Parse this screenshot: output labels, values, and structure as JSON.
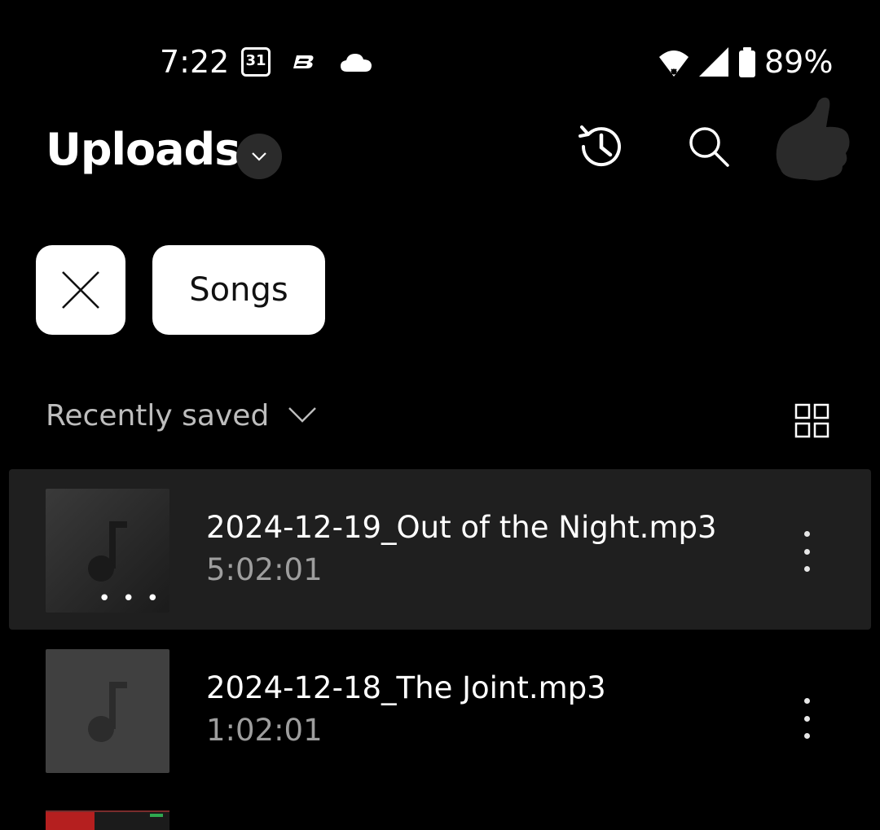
{
  "status_bar": {
    "time": "7:22",
    "calendar_day": "31",
    "battery_percent": "89%",
    "icons": [
      "calendar-icon",
      "b-app-icon",
      "cloud-icon",
      "wifi-icon",
      "signal-icon",
      "battery-icon"
    ]
  },
  "header": {
    "title": "Uploads",
    "actions": [
      "history-icon",
      "search-icon",
      "avatar"
    ]
  },
  "filters": {
    "chips": [
      "Songs"
    ]
  },
  "sort": {
    "label": "Recently saved"
  },
  "songs": [
    {
      "title": "2024-12-19_Out of the Night.mp3",
      "duration": "5:02:01",
      "selected": true
    },
    {
      "title": "2024-12-18_The Joint.mp3",
      "duration": "1:02:01",
      "selected": false
    }
  ],
  "colors": {
    "background": "#000000",
    "selected_row": "#1f1f1f",
    "chip_bg": "#ffffff",
    "secondary_text": "#9e9e9e"
  }
}
